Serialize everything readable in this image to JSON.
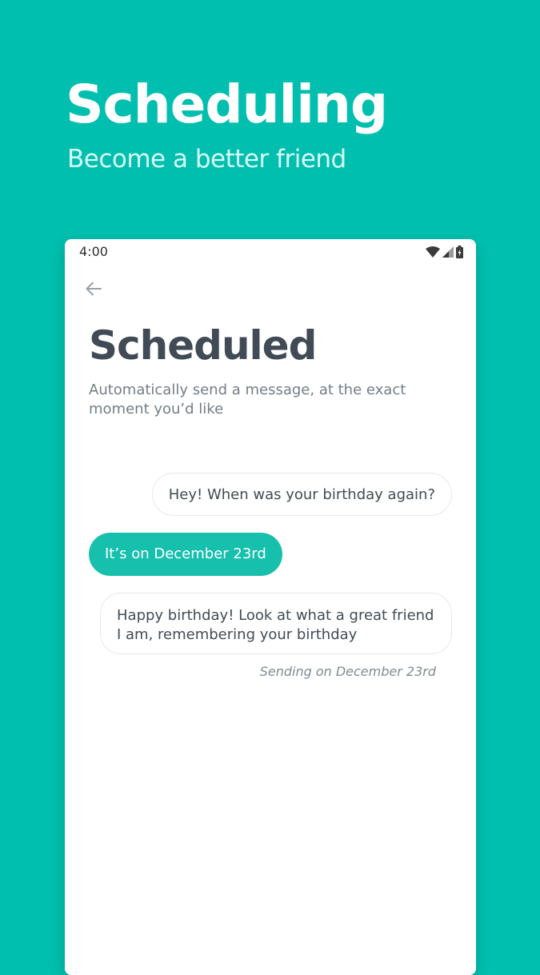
{
  "promo": {
    "title": "Scheduling",
    "subtitle": "Become a better friend"
  },
  "status_bar": {
    "time": "4:00",
    "icons": [
      "wifi-icon",
      "cell-signal-icon",
      "battery-icon"
    ]
  },
  "screen": {
    "back_icon": "arrow-left-icon",
    "title": "Scheduled",
    "description": "Automatically send a message, at the exact moment you’d like"
  },
  "conversation": {
    "incoming": "Hey! When was your birthday again?",
    "outgoing": "It’s on December 23rd",
    "scheduled_message": "Happy birthday! Look at what a great friend I am, remembering your birthday",
    "scheduled_note": "Sending on December 23rd"
  },
  "colors": {
    "background": "#00bfae",
    "accent": "#17bfad",
    "title_text": "#414b55",
    "muted_text": "#737d87"
  }
}
